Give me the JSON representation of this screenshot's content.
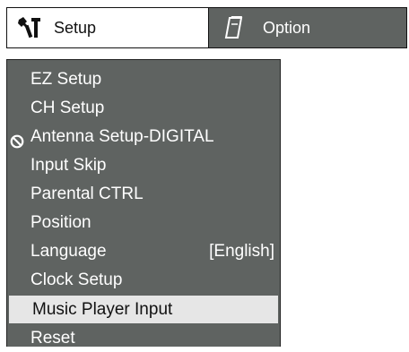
{
  "tabs": [
    {
      "label": "Setup",
      "icon": "wrench-icon",
      "active": true
    },
    {
      "label": "Option",
      "icon": "notepad-icon",
      "active": false
    }
  ],
  "menu": {
    "items": [
      {
        "label": "EZ Setup"
      },
      {
        "label": "CH Setup"
      },
      {
        "label": "Antenna Setup-DIGITAL",
        "icon": "prohibited-icon",
        "disabled": true
      },
      {
        "label": "Input Skip"
      },
      {
        "label": "Parental CTRL"
      },
      {
        "label": "Position"
      },
      {
        "label": "Language",
        "value": "[English]"
      },
      {
        "label": "Clock Setup"
      },
      {
        "label": "Music Player Input",
        "selected": true
      },
      {
        "label": "Reset"
      }
    ]
  },
  "colors": {
    "menu_bg": "#5f6361",
    "selected_bg": "#e6e6e6",
    "text_light": "#ffffff",
    "text_dark": "#111111"
  }
}
